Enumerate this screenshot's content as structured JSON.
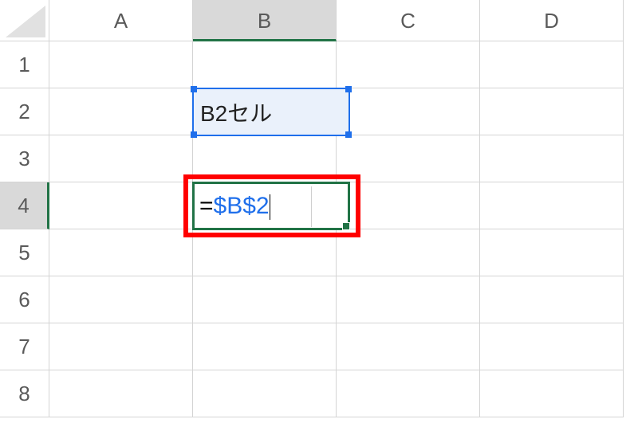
{
  "columns": [
    "A",
    "B",
    "C",
    "D"
  ],
  "rows": [
    "1",
    "2",
    "3",
    "4",
    "5",
    "6",
    "7",
    "8"
  ],
  "selected_column_index": 1,
  "selected_row_index": 3,
  "referenced_cell": {
    "col": 1,
    "row": 1,
    "text": "B2セル"
  },
  "active_cell": {
    "col": 1,
    "row": 3,
    "formula_prefix": "=",
    "formula_ref": "$B$2"
  },
  "colors": {
    "selection_green": "#217346",
    "reference_blue": "#1f6feb",
    "annotation_red": "#ff0000"
  }
}
